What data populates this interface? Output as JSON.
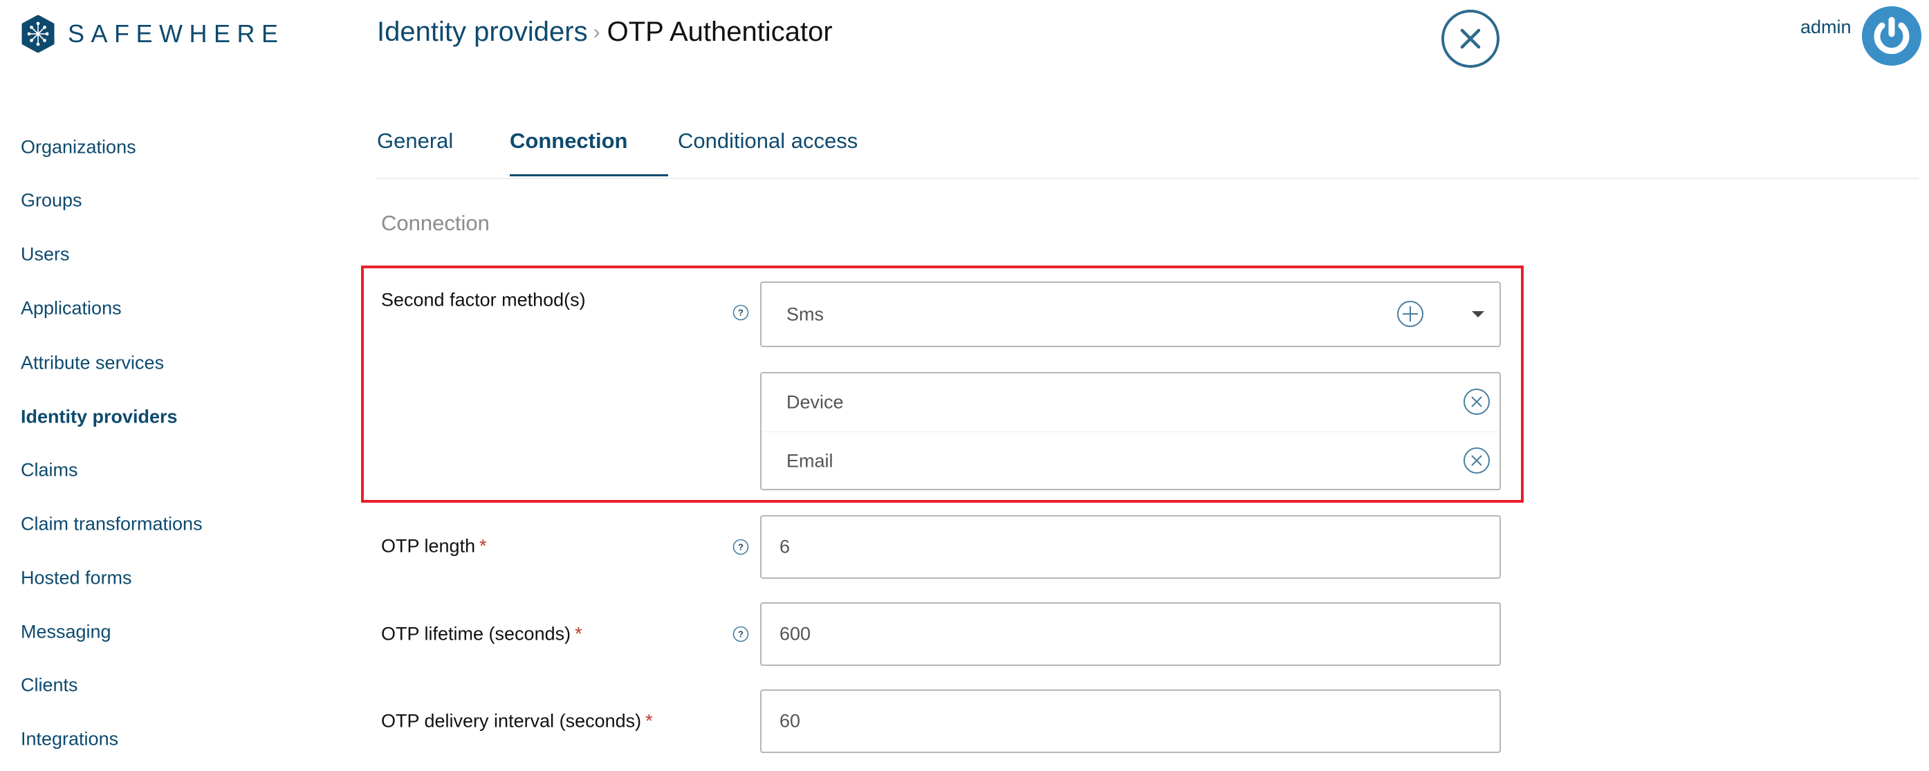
{
  "brand": {
    "name": "SAFEWHERE",
    "color": "#0e4a6e"
  },
  "header": {
    "breadcrumb_parent": "Identity providers",
    "breadcrumb_separator": "›",
    "breadcrumb_current": "OTP Authenticator",
    "user_name": "admin"
  },
  "sidebar": {
    "items": [
      {
        "label": "Organizations"
      },
      {
        "label": "Groups"
      },
      {
        "label": "Users"
      },
      {
        "label": "Applications"
      },
      {
        "label": "Attribute services"
      },
      {
        "label": "Identity providers",
        "active": true
      },
      {
        "label": "Claims"
      },
      {
        "label": "Claim transformations"
      },
      {
        "label": "Hosted forms"
      },
      {
        "label": "Messaging"
      },
      {
        "label": "Clients"
      },
      {
        "label": "Integrations"
      }
    ]
  },
  "tabs": [
    {
      "label": "General"
    },
    {
      "label": "Connection",
      "active": true
    },
    {
      "label": "Conditional access"
    }
  ],
  "section": {
    "title": "Connection"
  },
  "form": {
    "second_factor": {
      "label": "Second factor method(s)",
      "selected": "Sms",
      "added_methods": [
        "Device",
        "Email"
      ]
    },
    "otp_length": {
      "label": "OTP length",
      "required_mark": "*",
      "value": "6"
    },
    "otp_lifetime": {
      "label": "OTP lifetime (seconds)",
      "required_mark": "*",
      "value": "600"
    },
    "otp_delivery_interval": {
      "label": "OTP delivery interval (seconds)",
      "required_mark": "*",
      "value": "60"
    }
  },
  "colors": {
    "accent": "#0e4a6e",
    "highlight": "#e8202a",
    "avatar": "#3a8fc7",
    "icon": "#4a7fa0"
  }
}
